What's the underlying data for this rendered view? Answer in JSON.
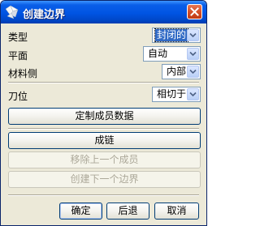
{
  "window": {
    "title": "创建边界"
  },
  "fields": {
    "type": {
      "label": "类型",
      "value": "封闭的"
    },
    "plane": {
      "label": "平面",
      "value": "自动"
    },
    "material_side": {
      "label": "材料侧",
      "value": "内部"
    },
    "tool_position": {
      "label": "刀位",
      "value": "相切于"
    }
  },
  "buttons": {
    "custom_member_data": "定制成员数据",
    "chain": "成链",
    "remove_previous_member": "移除上一个成员",
    "create_next_boundary": "创建下一个边界",
    "ok": "确定",
    "back": "后退",
    "cancel": "取消"
  },
  "colors": {
    "titlebar": "#0054e3",
    "dialog_bg": "#ece9d8",
    "selection": "#316ac5",
    "close_button": "#d4502a"
  }
}
